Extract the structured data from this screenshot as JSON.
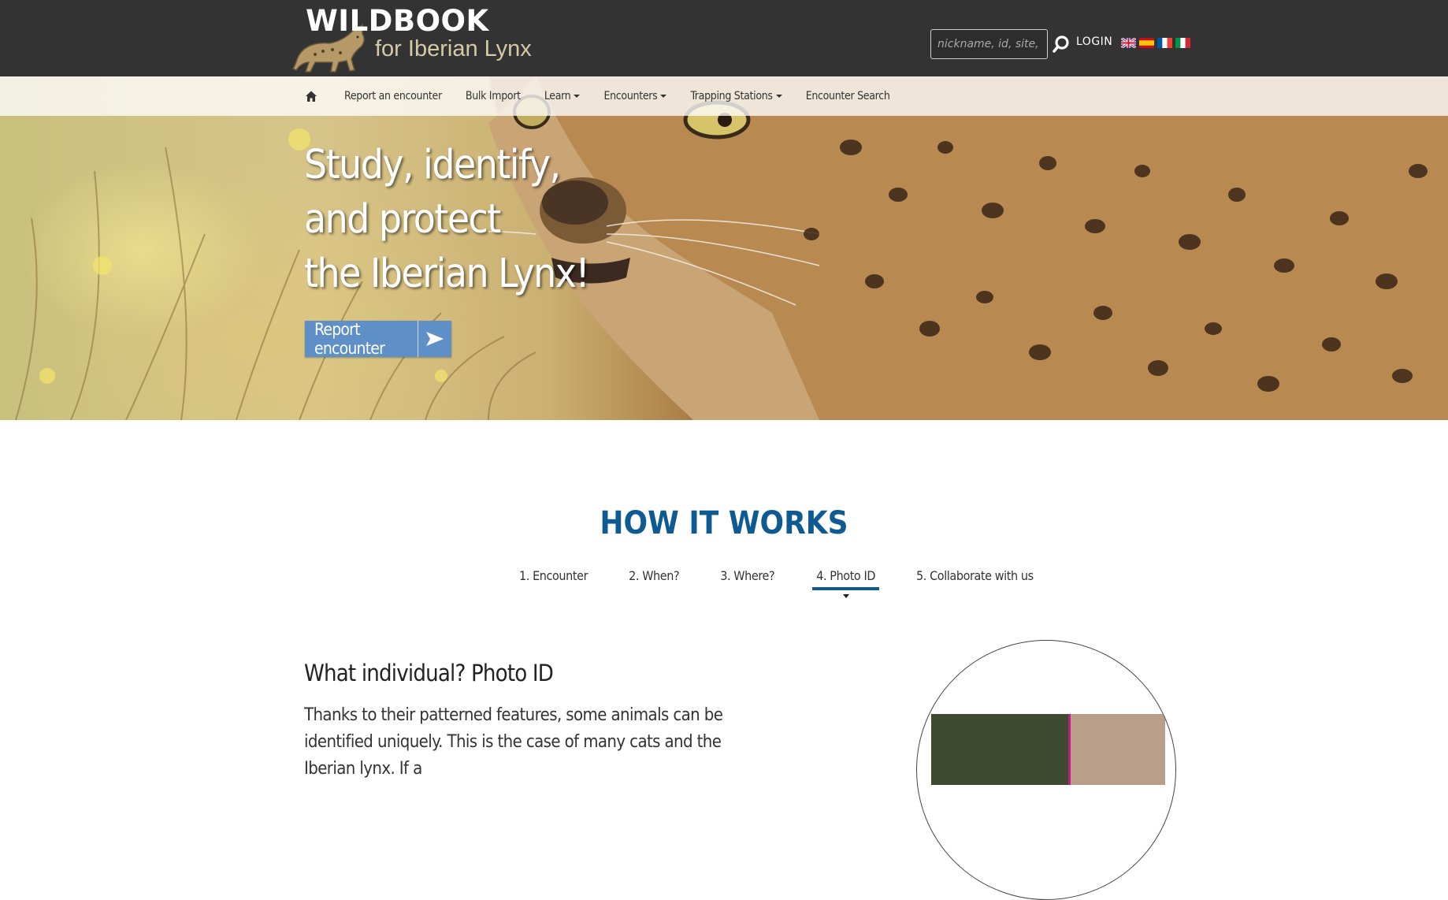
{
  "header": {
    "logo_title": "WILDBOOK",
    "logo_subtitle": "for Iberian Lynx",
    "search_placeholder": "nickname, id, site, encounter",
    "login_label": "LOGIN",
    "languages": [
      "english-flag",
      "spanish-flag",
      "french-flag",
      "italian-flag"
    ]
  },
  "nav": {
    "home_icon": "home-icon",
    "items": [
      {
        "label": "Report an encounter",
        "dropdown": false
      },
      {
        "label": "Bulk Import",
        "dropdown": false
      },
      {
        "label": "Learn",
        "dropdown": true
      },
      {
        "label": "Encounters",
        "dropdown": true
      },
      {
        "label": "Trapping Stations",
        "dropdown": true
      },
      {
        "label": "Encounter Search",
        "dropdown": false
      }
    ]
  },
  "hero": {
    "lines": [
      "Study, identify,",
      "and protect",
      "the Iberian Lynx!"
    ],
    "button_label": "Report encounter"
  },
  "how_it_works": {
    "title": "HOW IT WORKS",
    "steps": [
      "1. Encounter",
      "2. When?",
      "3. Where?",
      "4. Photo ID",
      "5. Collaborate with us"
    ],
    "active_step": "4. Photo ID",
    "section_title": "What individual? Photo ID",
    "section_text": "Thanks to their patterned features, some animals can be identified uniquely. This is the case of many cats and the Iberian lynx. If a"
  },
  "colors": {
    "top_bar": "#333333",
    "accent_blue": "#0e5a92",
    "button_blue": "#5e8fc7"
  }
}
